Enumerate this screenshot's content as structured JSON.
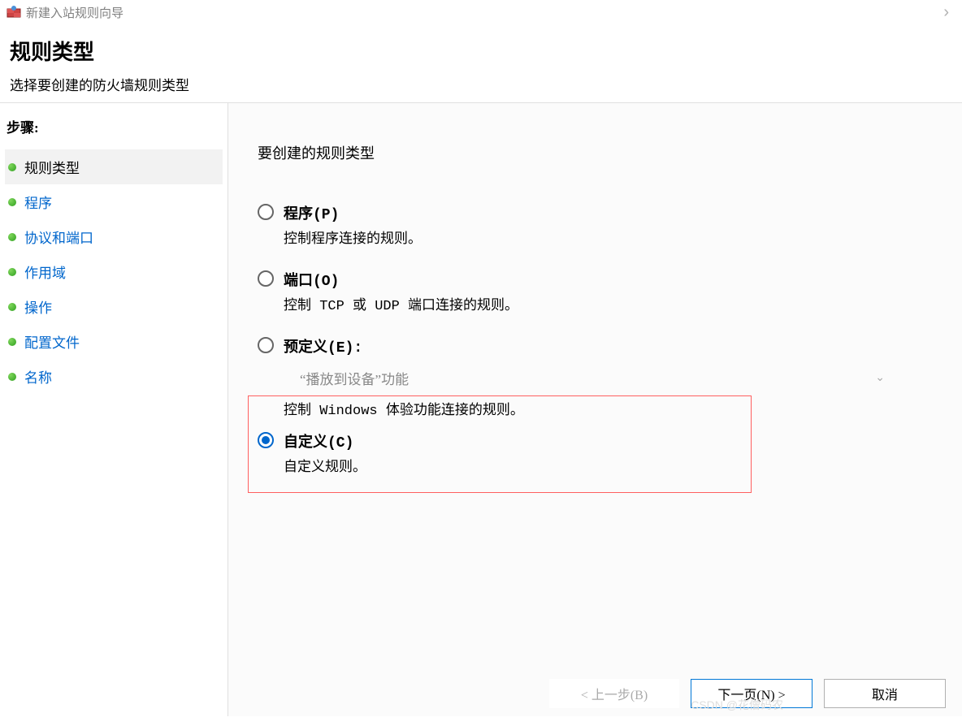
{
  "titlebar": {
    "title": "新建入站规则向导"
  },
  "header": {
    "title": "规则类型",
    "subtitle": "选择要创建的防火墙规则类型"
  },
  "sidebar": {
    "heading": "步骤:",
    "items": [
      {
        "label": "规则类型",
        "active": true
      },
      {
        "label": "程序",
        "active": false
      },
      {
        "label": "协议和端口",
        "active": false
      },
      {
        "label": "作用域",
        "active": false
      },
      {
        "label": "操作",
        "active": false
      },
      {
        "label": "配置文件",
        "active": false
      },
      {
        "label": "名称",
        "active": false
      }
    ]
  },
  "main": {
    "heading": "要创建的规则类型",
    "options": [
      {
        "label": "程序(P)",
        "desc": "控制程序连接的规则。",
        "selected": false
      },
      {
        "label": "端口(O)",
        "desc": "控制 TCP 或 UDP 端口连接的规则。",
        "selected": false
      },
      {
        "label": "预定义(E):",
        "dropdown": "“播放到设备”功能",
        "desc": "控制 Windows 体验功能连接的规则。",
        "selected": false
      },
      {
        "label": "自定义(C)",
        "desc": "自定义规则。",
        "selected": true
      }
    ]
  },
  "buttons": {
    "back": "< 上一步(B)",
    "next": "下一页(N) >",
    "cancel": "取消"
  },
  "watermark": "CSDN @花僧码农"
}
